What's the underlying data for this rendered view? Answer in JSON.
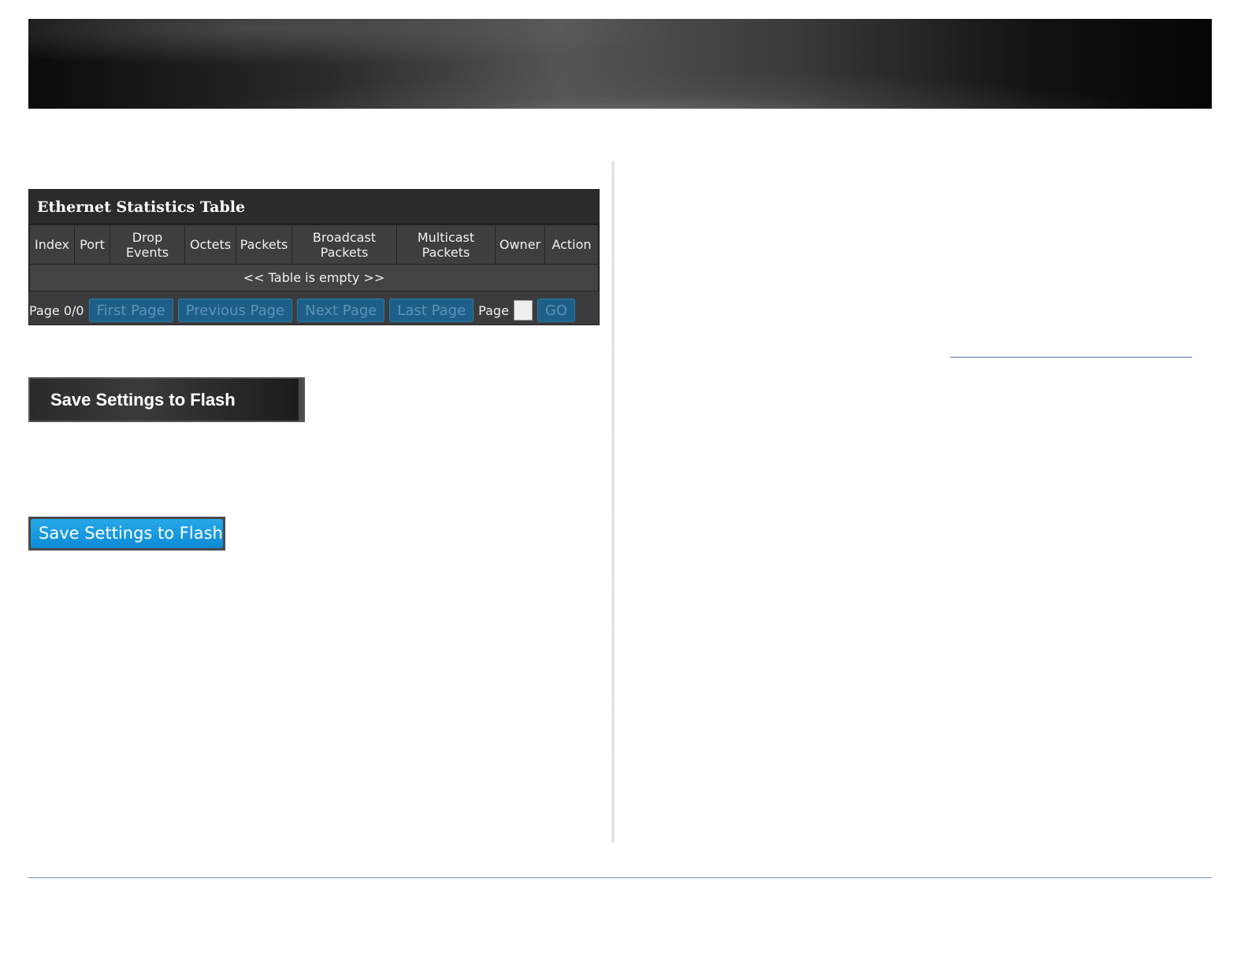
{
  "panel": {
    "title": "Ethernet Statistics Table",
    "columns": [
      "Index",
      "Port",
      "Drop\nEvents",
      "Octets",
      "Packets",
      "Broadcast\nPackets",
      "Multicast\nPackets",
      "Owner",
      "Action"
    ],
    "empty_message": "<< Table is empty >>"
  },
  "pager": {
    "page_info": "Page 0/0",
    "first": "First Page",
    "previous": "Previous Page",
    "next": "Next Page",
    "last": "Last Page",
    "page_label": "Page",
    "page_value": "",
    "go": "GO"
  },
  "buttons": {
    "save_dark": "Save Settings to Flash",
    "save_blue": "Save Settings to Flash"
  }
}
